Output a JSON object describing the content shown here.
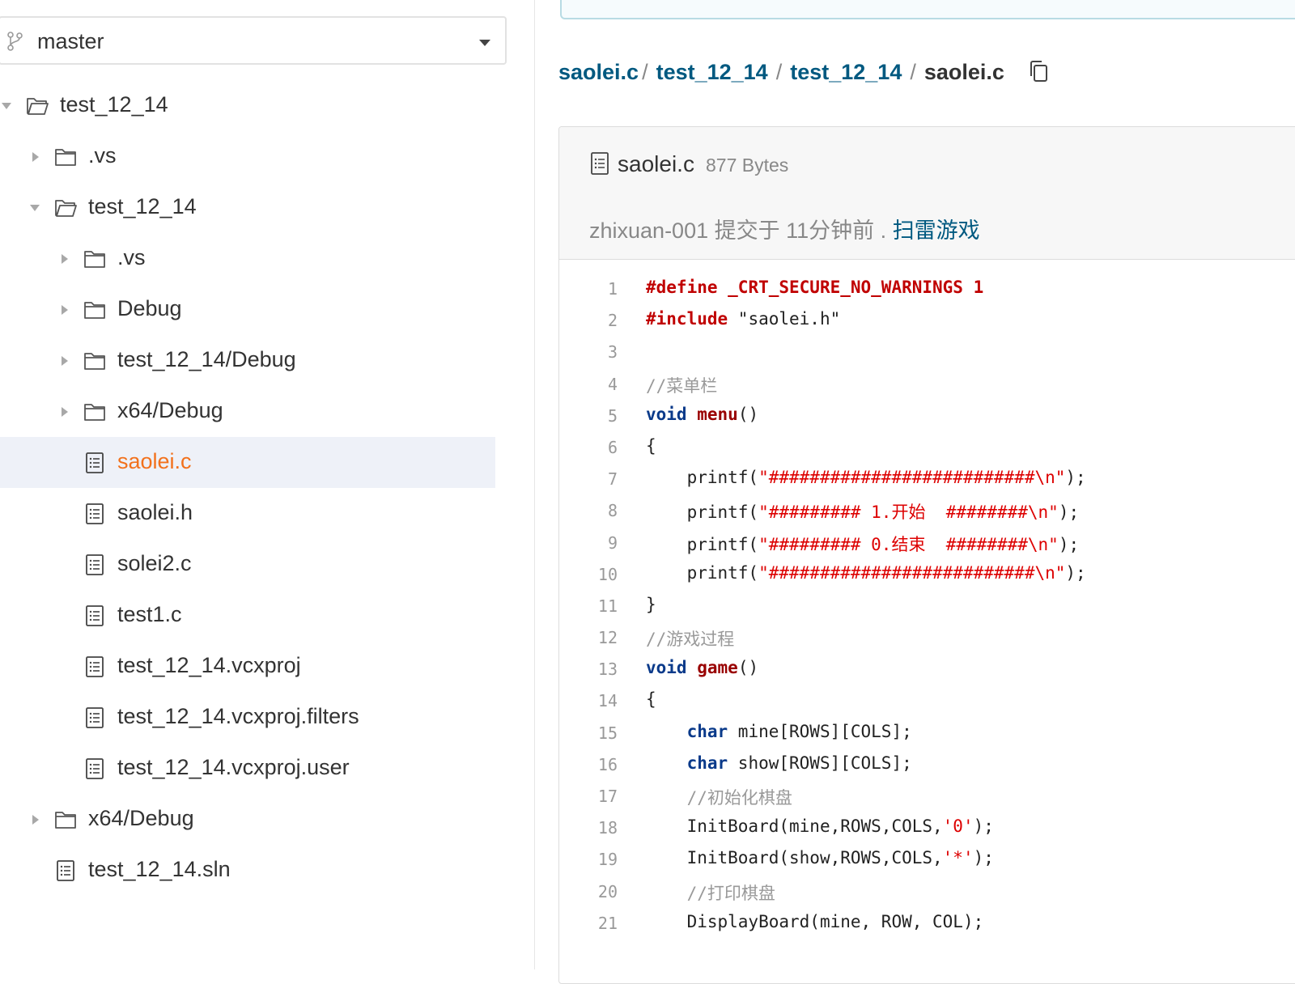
{
  "branch": {
    "label": "master",
    "icon": "branch-icon"
  },
  "tree": {
    "items": [
      {
        "name": "test_12_14",
        "type": "folder",
        "expanded": true
      },
      {
        "name": ".vs",
        "type": "folder",
        "expanded": false
      },
      {
        "name": "test_12_14",
        "type": "folder",
        "expanded": true
      },
      {
        "name": ".vs",
        "type": "folder",
        "expanded": false
      },
      {
        "name": "Debug",
        "type": "folder",
        "expanded": false
      },
      {
        "name": "test_12_14/Debug",
        "type": "folder",
        "expanded": false
      },
      {
        "name": "x64/Debug",
        "type": "folder",
        "expanded": false
      },
      {
        "name": "saolei.c",
        "type": "file",
        "active": true
      },
      {
        "name": "saolei.h",
        "type": "file"
      },
      {
        "name": "solei2.c",
        "type": "file"
      },
      {
        "name": "test1.c",
        "type": "file"
      },
      {
        "name": "test_12_14.vcxproj",
        "type": "file"
      },
      {
        "name": "test_12_14.vcxproj.filters",
        "type": "file"
      },
      {
        "name": "test_12_14.vcxproj.user",
        "type": "file"
      },
      {
        "name": "x64/Debug",
        "type": "folder",
        "expanded": false
      },
      {
        "name": "test_12_14.sln",
        "type": "file"
      }
    ]
  },
  "breadcrumb": {
    "items": [
      "saolei.c",
      "test_12_14",
      "test_12_14"
    ],
    "current": "saolei.c",
    "sep": "/",
    "copy_icon": "copy-icon"
  },
  "file": {
    "name": "saolei.c",
    "size": "877 Bytes",
    "author": "zhixuan-001",
    "commit_text": "提交于 11分钟前 .",
    "commit_message": "扫雷游戏"
  },
  "code": {
    "lines": [
      "1",
      "2",
      "3",
      "4",
      "5",
      "6",
      "7",
      "8",
      "9",
      "10",
      "11",
      "12",
      "13",
      "14",
      "15",
      "16",
      "17",
      "18",
      "19",
      "20",
      "21"
    ],
    "tokens": {
      "l1a": "#define",
      "l1b": " _CRT_SECURE_NO_WARNINGS 1",
      "l2a": "#include",
      "l2b": " \"saolei.h\"",
      "l4": "//菜单栏",
      "l5a": "void",
      "l5b": "menu",
      "l5c": "()",
      "l6": "{",
      "printf": "printf(",
      "l7s": "\"##########################\\n\"",
      "l8s": "\"######### 1.开始  ########\\n\"",
      "l9s": "\"######### 0.结束  ########\\n\"",
      "l10s": "\"##########################\\n\"",
      "endp": ");",
      "l11": "}",
      "l12": "//游戏过程",
      "l13a": "void",
      "l13b": "game",
      "l13c": "()",
      "l14": "{",
      "char": "char",
      "l15b": " mine[ROWS][COLS];",
      "l16b": " show[ROWS][COLS];",
      "l17": "//初始化棋盘",
      "l18a": "InitBoard(mine,ROWS,COLS,",
      "l18s": "'0'",
      "l18c": ");",
      "l19a": "InitBoard(show,ROWS,COLS,",
      "l19s": "'*'",
      "l19c": ");",
      "l20": "//打印棋盘",
      "l21": "DisplayBoard(mine, ROW, COL);"
    }
  }
}
